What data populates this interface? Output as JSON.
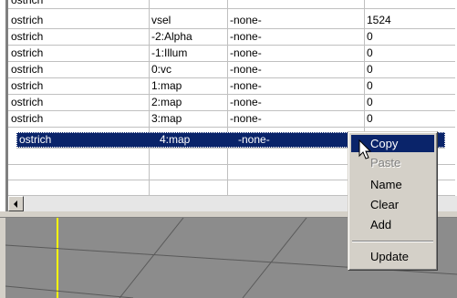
{
  "grid": {
    "rows": [
      {
        "c0": "ostrich",
        "c1": "vsel",
        "c2": "-none-",
        "c3": "1524"
      },
      {
        "c0": "ostrich",
        "c1": "-2:Alpha",
        "c2": "-none-",
        "c3": "0"
      },
      {
        "c0": "ostrich",
        "c1": "-1:Illum",
        "c2": "-none-",
        "c3": "0"
      },
      {
        "c0": "ostrich",
        "c1": "0:vc",
        "c2": "-none-",
        "c3": "0"
      },
      {
        "c0": "ostrich",
        "c1": "1:map",
        "c2": "-none-",
        "c3": "0"
      },
      {
        "c0": "ostrich",
        "c1": "2:map",
        "c2": "-none-",
        "c3": "0"
      },
      {
        "c0": "ostrich",
        "c1": "3:map",
        "c2": "-none-",
        "c3": "0"
      },
      {
        "c0": "ostrich",
        "c1": "4:map",
        "c2": "-none-",
        "c3": ""
      }
    ],
    "selected_row": 7
  },
  "context_menu": {
    "items": [
      {
        "label": "Copy",
        "state": "highlighted"
      },
      {
        "label": "Paste",
        "state": "disabled"
      },
      {
        "label": "Name",
        "state": "normal"
      },
      {
        "label": "Clear",
        "state": "normal"
      },
      {
        "label": "Add",
        "state": "normal"
      },
      {
        "label": "Update",
        "state": "normal"
      }
    ]
  },
  "icons": {
    "scroll_left": "arrow-left-icon",
    "cursor": "mouse-pointer-icon"
  },
  "colors": {
    "selection": "#0a246a",
    "menu_bg": "#d4d0c8",
    "viewport_bg": "#8c8c8c",
    "axis_line": "#ffff00"
  }
}
